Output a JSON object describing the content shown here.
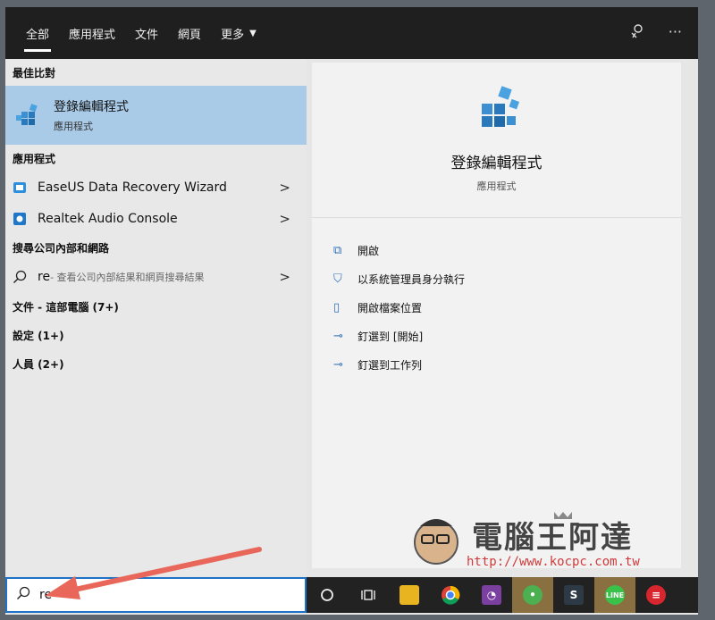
{
  "tabs": [
    {
      "label": "全部",
      "active": true
    },
    {
      "label": "應用程式"
    },
    {
      "label": "文件"
    },
    {
      "label": "網頁"
    },
    {
      "label": "更多"
    }
  ],
  "top_icons": [
    "feedback-icon",
    "more-options-icon"
  ],
  "left": {
    "best_match_header": "最佳比對",
    "best_match": {
      "title": "登錄編輯程式",
      "subtitle": "應用程式",
      "icon": "regedit-icon"
    },
    "apps_header": "應用程式",
    "apps": [
      {
        "label": "EaseUS Data Recovery Wizard",
        "icon": "easeus-icon"
      },
      {
        "label": "Realtek Audio Console",
        "icon": "realtek-icon"
      }
    ],
    "web_header": "搜尋公司內部和網路",
    "web_query": {
      "query": "re",
      "suffix": " - 查看公司內部結果和網頁搜尋結果"
    },
    "documents": "文件 - 這部電腦 (7+)",
    "settings": "設定 (1+)",
    "people": "人員 (2+)"
  },
  "right": {
    "title": "登錄編輯程式",
    "subtitle": "應用程式",
    "actions": [
      {
        "label": "開啟",
        "icon": "open-icon"
      },
      {
        "label": "以系統管理員身分執行",
        "icon": "shield-run-icon"
      },
      {
        "label": "開啟檔案位置",
        "icon": "file-location-icon"
      },
      {
        "label": "釘選到 [開始]",
        "icon": "pin-start-icon"
      },
      {
        "label": "釘選到工作列",
        "icon": "pin-taskbar-icon"
      }
    ]
  },
  "search": {
    "value": "re"
  },
  "taskbar": [
    "cortana-icon",
    "task-view-icon",
    "file-explorer-icon",
    "chrome-icon",
    "app-purple-icon",
    "app-keepass-icon",
    "app-s-icon",
    "line-icon",
    "expressvpn-icon"
  ],
  "watermark": {
    "text": "電腦王阿達",
    "url": "http://www.kocpc.com.tw"
  },
  "colors": {
    "accent": "#1e73c8",
    "selected": "#a9cbe8",
    "topbar": "#1f1f1f",
    "arrow": "#e8675a"
  }
}
